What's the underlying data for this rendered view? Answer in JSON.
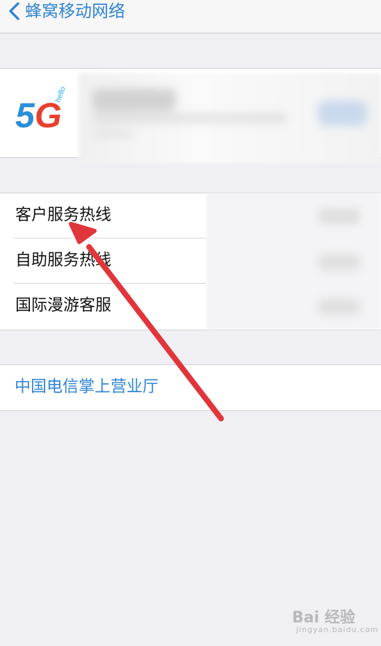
{
  "nav": {
    "back_label": "蜂窝移动网络"
  },
  "carrier_card": {
    "logo_main": "5G",
    "logo_sub": "hello"
  },
  "service_list": {
    "items": [
      {
        "label": "客户服务热线"
      },
      {
        "label": "自助服务热线"
      },
      {
        "label": "国际漫游客服"
      }
    ]
  },
  "link": {
    "label": "中国电信掌上营业厅"
  },
  "watermark": {
    "main": "Bai 经验",
    "sub": "jingyan.baidu.com"
  },
  "colors": {
    "link_blue": "#2f84d4",
    "annotation_red": "#e0363b",
    "background": "#efeff4"
  }
}
